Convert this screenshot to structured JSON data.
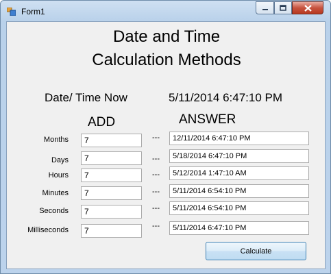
{
  "window": {
    "title": "Form1"
  },
  "header": {
    "line1": "Date and Time",
    "line2": "Calculation Methods"
  },
  "now": {
    "label": "Date/ Time Now",
    "value": "5/11/2014 6:47:10 PM"
  },
  "columns": {
    "add": "ADD",
    "answer": "ANSWER"
  },
  "separator": "---",
  "rows": [
    {
      "label": "Months",
      "add": "7",
      "answer": "12/11/2014 6:47:10 PM"
    },
    {
      "label": "Days",
      "add": "7",
      "answer": "5/18/2014 6:47:10 PM"
    },
    {
      "label": "Hours",
      "add": "7",
      "answer": "5/12/2014 1:47:10 AM"
    },
    {
      "label": "Minutes",
      "add": "7",
      "answer": "5/11/2014 6:54:10 PM"
    },
    {
      "label": "Seconds",
      "add": "7",
      "answer": "5/11/2014 6:54:10 PM"
    },
    {
      "label": "Milliseconds",
      "add": "7",
      "answer": "5/11/2014 6:47:10 PM"
    }
  ],
  "buttons": {
    "calculate": "Calculate"
  },
  "colors": {
    "titlebar": "#b9d1ea",
    "client": "#f0f0f0",
    "close": "#c7533f",
    "button_border": "#3c7fb1"
  }
}
